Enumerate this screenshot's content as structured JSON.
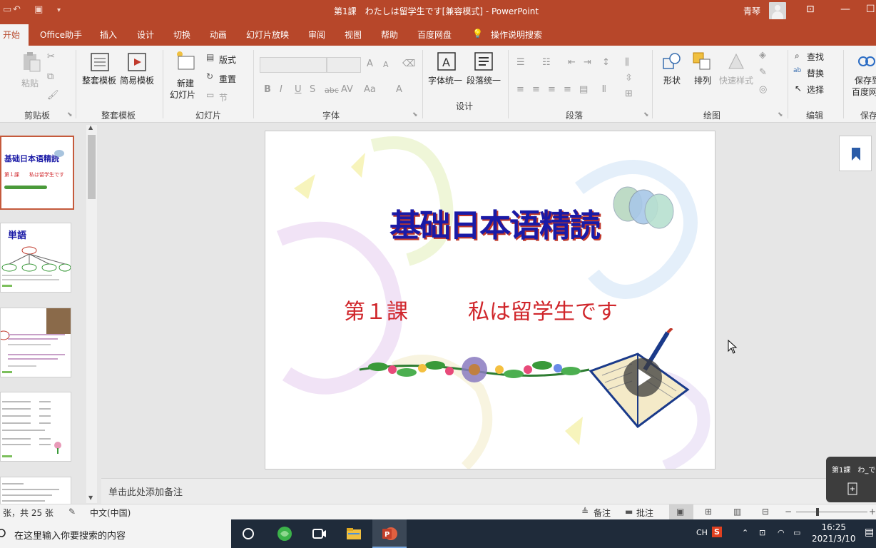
{
  "window": {
    "title": "第1課　わたしは留学生です[兼容模式]  -  PowerPoint",
    "user": "青琴",
    "qat": {
      "undo": "↶",
      "redo": "↷",
      "present": "▣",
      "more": "▾"
    },
    "controls": {
      "ribbon_display": "⊡",
      "minimize": "—",
      "maximize": "☐"
    }
  },
  "tabs": [
    "开始",
    "Office助手",
    "插入",
    "设计",
    "切换",
    "动画",
    "幻灯片放映",
    "审阅",
    "视图",
    "帮助",
    "百度网盘",
    "操作说明搜索"
  ],
  "ribbon": {
    "clipboard": {
      "label": "剪贴板",
      "paste": "粘贴"
    },
    "template": {
      "label": "整套模板",
      "full": "整套模板",
      "simple": "简易模板"
    },
    "slides": {
      "label": "幻灯片",
      "new_line1": "新建",
      "new_line2": "幻灯片",
      "layout": "版式",
      "reset": "重置",
      "section": "节"
    },
    "font": {
      "label": "字体",
      "bold": "B",
      "italic": "I",
      "underline": "U",
      "shadow": "S",
      "strike": "abc",
      "spacing": "AV",
      "case": "Aa",
      "color": "A",
      "grow": "A",
      "shrink": "A"
    },
    "design": {
      "label": "设计",
      "font_unify": "字体统一",
      "para_unify": "段落统一"
    },
    "paragraph": {
      "label": "段落"
    },
    "drawing": {
      "label": "绘图",
      "shape": "形状",
      "arrange": "排列",
      "quick_style": "快速样式"
    },
    "editing": {
      "label": "编辑",
      "find": "查找",
      "replace": "替换",
      "select": "选择"
    },
    "save": {
      "label": "保存",
      "line1": "保存到",
      "line2": "百度网"
    }
  },
  "slide": {
    "title": "基础日本语精読",
    "lesson": "第１課",
    "subtitle": "私は留学生です"
  },
  "thumbnails": {
    "t1_title": "基础日本语精読",
    "t1_sub": "第１課　　私は留学生です",
    "t2_title": "単語"
  },
  "notes": {
    "placeholder": "单击此处添加备注"
  },
  "status": {
    "slide_count": "张，共 25 张",
    "language": "中文(中国)",
    "notes": "备注",
    "comments": "批注"
  },
  "popup": {
    "title": "第1課　わ_で"
  },
  "taskbar": {
    "search_placeholder": "在这里输入你要搜索的内容",
    "ime": "CH",
    "ime_s": "S",
    "time": "16:25",
    "date": "2021/3/10"
  },
  "colors": {
    "accent": "#b7472a",
    "title_blue": "#1a1aa6",
    "subtitle_red": "#d0262b"
  }
}
